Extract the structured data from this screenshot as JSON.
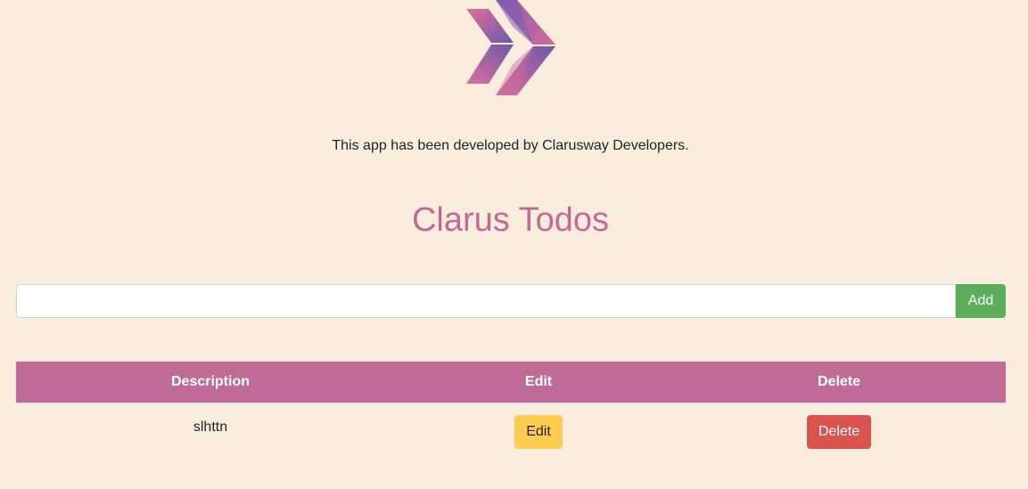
{
  "logo": {
    "icon": "double-chevron-logo",
    "colors": [
      "#6e5aa8",
      "#d06a9c"
    ]
  },
  "credits": "This app has been developed by Clarusway Developers.",
  "title": "Clarus Todos",
  "form": {
    "input_value": "",
    "add_label": "Add"
  },
  "table": {
    "headers": {
      "description": "Description",
      "edit": "Edit",
      "delete": "Delete"
    },
    "rows": [
      {
        "description": "slhttn",
        "edit_label": "Edit",
        "delete_label": "Delete"
      }
    ]
  },
  "colors": {
    "background": "#f8ecdd",
    "accent": "#c06b95",
    "add": "#5cad5c",
    "edit": "#fecc4f",
    "delete": "#d9534f"
  }
}
